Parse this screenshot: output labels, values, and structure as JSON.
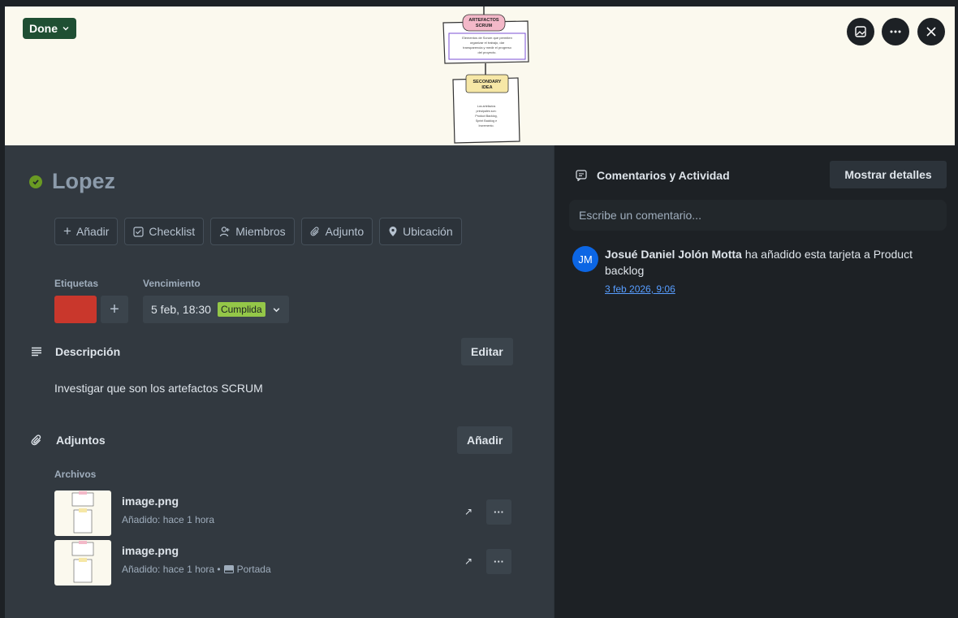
{
  "cover": {
    "status_label": "Done",
    "card_top_title": "ARTEFACTOS SCRUM",
    "card_top_text": "Elementos de Scrum que permiten organizar el trabajo, dar transparencia y medir el progreso del proyecto.",
    "card_bottom_title": "SECONDARY IDEA",
    "card_bottom_text": "Los artefactos principales son: Product Backlog, Sprint Backlog e Incremento."
  },
  "card": {
    "title": "Lopez",
    "actions": [
      {
        "icon": "plus-icon",
        "label": "Añadir"
      },
      {
        "icon": "checklist-icon",
        "label": "Checklist"
      },
      {
        "icon": "members-icon",
        "label": "Miembros"
      },
      {
        "icon": "paperclip-icon",
        "label": "Adjunto"
      },
      {
        "icon": "location-pin-icon",
        "label": "Ubicación"
      }
    ],
    "labels_heading": "Etiquetas",
    "label_color": "#c9372c",
    "due_heading": "Vencimiento",
    "due_date": "5 feb, 18:30",
    "due_status": "Cumplida"
  },
  "description": {
    "heading": "Descripción",
    "edit_label": "Editar",
    "text": "Investigar que son los artefactos SCRUM"
  },
  "attachments": {
    "heading": "Adjuntos",
    "add_label": "Añadir",
    "files_heading": "Archivos",
    "files": [
      {
        "name": "image.png",
        "meta": "Añadido: hace 1 hora",
        "cover_label": ""
      },
      {
        "name": "image.png",
        "meta": "Añadido: hace 1 hora •",
        "cover_label": "Portada"
      }
    ]
  },
  "activity": {
    "heading": "Comentarios y Actividad",
    "show_details": "Mostrar detalles",
    "comment_placeholder": "Escribe un comentario...",
    "avatar_initials": "JM",
    "user": "Josué Daniel Jolón Motta",
    "action_text": "ha añadido esta tarjeta a Product backlog",
    "timestamp": "3 feb 2026, 9:06"
  },
  "colors": {
    "status_done": "#1f4f33",
    "due_badge": "#94c748",
    "link": "#579dff"
  }
}
